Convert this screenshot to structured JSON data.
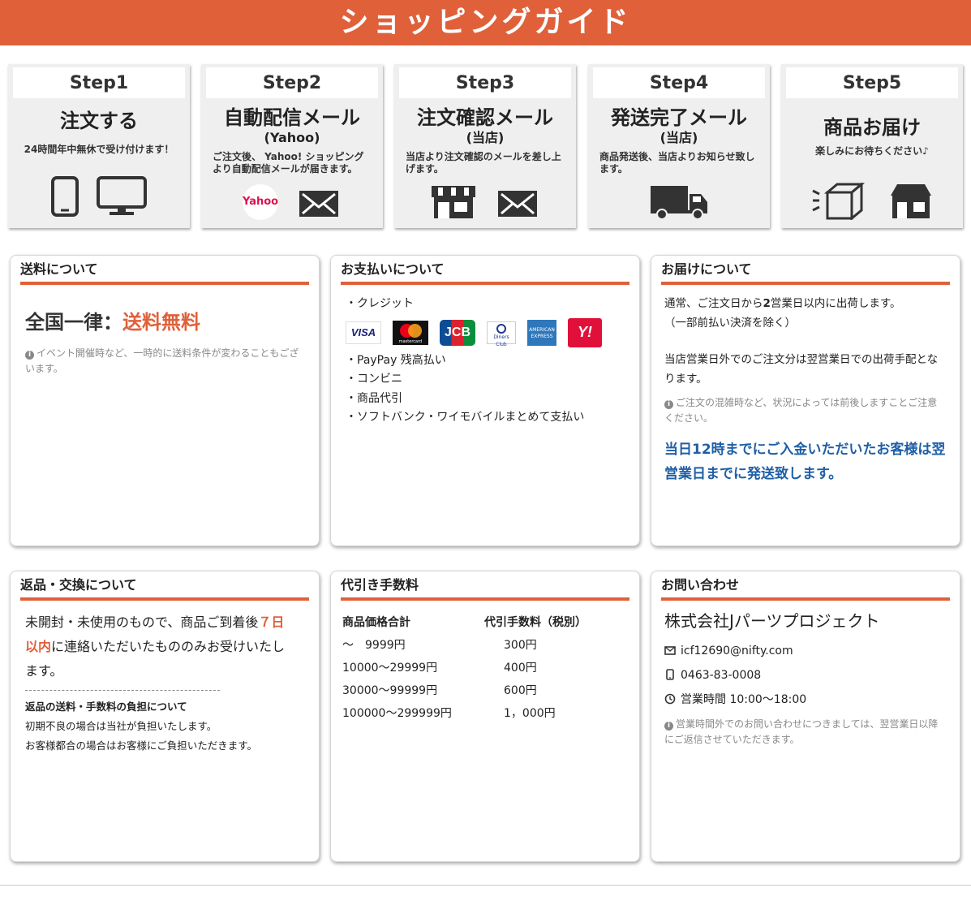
{
  "header": {
    "title": "ショッピングガイド"
  },
  "steps": [
    {
      "num": "Step1",
      "title": "注文する",
      "sub": "",
      "desc": "24時間年中無休で受け付けます！"
    },
    {
      "num": "Step2",
      "title": "自動配信メール",
      "sub": "(Yahoo)",
      "desc": "ご注文後、 Yahoo! ショッピングより自動配信メールが届きます。"
    },
    {
      "num": "Step3",
      "title": "注文確認メール",
      "sub": "(当店)",
      "desc": "当店より注文確認のメールを差し上げます。"
    },
    {
      "num": "Step4",
      "title": "発送完了メール",
      "sub": "(当店)",
      "desc": "商品発送後、当店よりお知らせ致します。"
    },
    {
      "num": "Step5",
      "title": "商品お届け",
      "sub": "",
      "desc": "楽しみにお待ちください♪"
    }
  ],
  "step2_yahoo_badge": "Yahoo",
  "shipping": {
    "title": "送料について",
    "headline_prefix": "全国一律：",
    "headline_highlight": "送料無料",
    "note": "イベント開催時など、一時的に送料条件が変わることもございます。"
  },
  "payment": {
    "title": "お支払いについて",
    "credit_label": "・クレジット",
    "card_logos": [
      "VISA",
      "mastercard",
      "JCB",
      "Diners Club",
      "AMERICAN EXPRESS",
      "Y!"
    ],
    "methods": [
      "・PayPay 残高払い",
      "・コンビニ",
      "・商品代引",
      "・ソフトバンク・ワイモバイルまとめて支払い"
    ]
  },
  "delivery": {
    "title": "お届けについて",
    "line1_pre": "通常、ご注文日から",
    "line1_num": "2",
    "line1_post": "営業日以内に出荷します。",
    "line2": "（一部前払い決済を除く）",
    "line3": "当店営業日外でのご注文分は翌営業日での出荷手配となります。",
    "note": "ご注文の混雑時など、状況によっては前後しますことご注意ください。",
    "highlight": "当日12時までにご入金いただいたお客様は翌営業日までに発送致します。"
  },
  "returns": {
    "title": "返品・交換について",
    "text_pre": "未開封・未使用のもので、商品ご到着後",
    "text_highlight": "７日以内",
    "text_post": "に連絡いただいたもののみお受けいたします。",
    "sub_title": "返品の送料・手数料の負担について",
    "sub_line1": "初期不良の場合は当社が負担いたします。",
    "sub_line2": "お客様都合の場合はお客様にご負担いただきます。"
  },
  "cod": {
    "title": "代引き手数料",
    "col1": "商品価格合計",
    "col2": "代引手数料（税別）",
    "rows": [
      {
        "range": "〜　9999円",
        "fee": "300円"
      },
      {
        "range": "10000〜29999円",
        "fee": "400円"
      },
      {
        "range": "30000〜99999円",
        "fee": "600円"
      },
      {
        "range": "100000〜299999円",
        "fee": "1，000円"
      }
    ]
  },
  "contact": {
    "title": "お問い合わせ",
    "company": "株式会社Jパーツプロジェクト",
    "email": "icf12690@nifty.com",
    "phone": "0463-83-0008",
    "hours": "営業時間 10:00〜18:00",
    "note": "営業時間外でのお問い合わせにつきましては、翌営業日以降にご返信させていただきます。"
  },
  "colors": {
    "accent": "#e0603a",
    "blue_text": "#1f5fa6"
  }
}
